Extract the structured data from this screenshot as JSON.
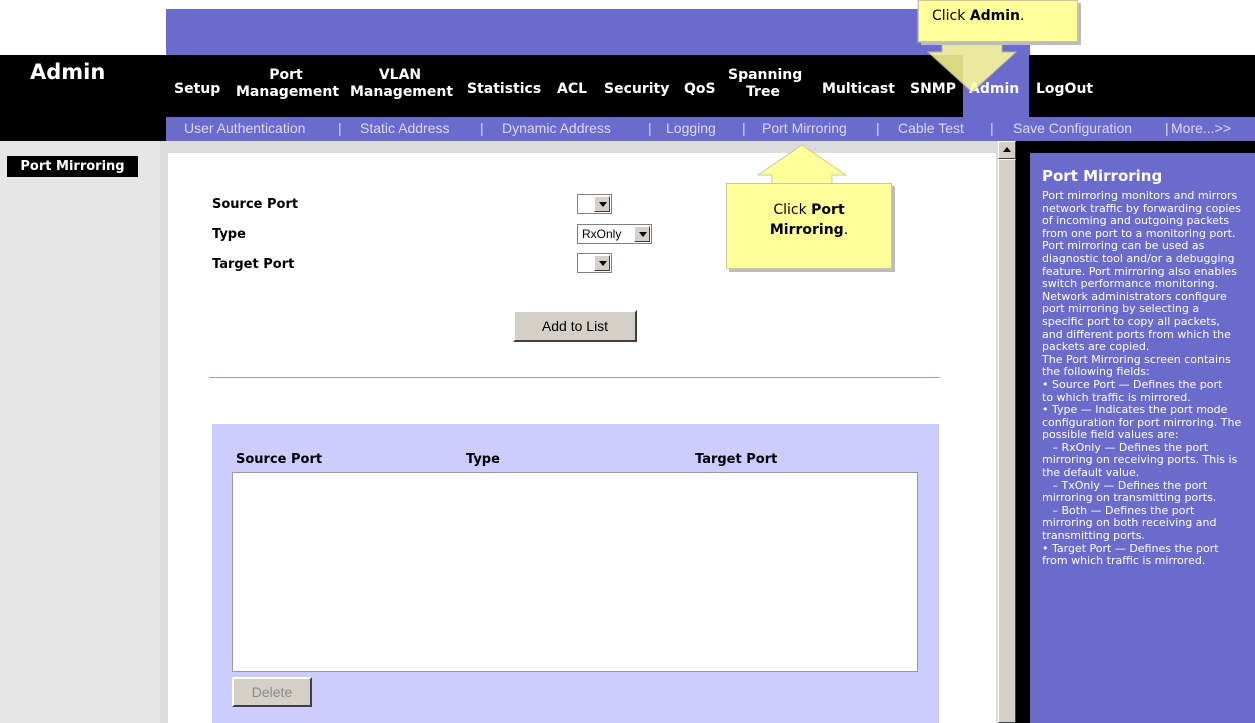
{
  "header": {
    "section_title": "Admin"
  },
  "nav": {
    "tabs": [
      {
        "line1": "Setup",
        "line2": ""
      },
      {
        "line1": "Port",
        "line2": "Management"
      },
      {
        "line1": "VLAN",
        "line2": "Management"
      },
      {
        "line1": "Statistics",
        "line2": ""
      },
      {
        "line1": "ACL",
        "line2": ""
      },
      {
        "line1": "Security",
        "line2": ""
      },
      {
        "line1": "QoS",
        "line2": ""
      },
      {
        "line1": "Spanning",
        "line2": "Tree"
      },
      {
        "line1": "Multicast",
        "line2": ""
      },
      {
        "line1": "SNMP",
        "line2": ""
      },
      {
        "line1": "Admin",
        "line2": ""
      },
      {
        "line1": "LogOut",
        "line2": ""
      }
    ],
    "active_tab": "Admin"
  },
  "subnav": {
    "items": [
      "User Authentication",
      "Static Address",
      "Dynamic Address",
      "Logging",
      "Port Mirroring",
      "Cable Test",
      "Save Configuration",
      "More...>>"
    ],
    "separator": "|"
  },
  "sidebar": {
    "label": "Port Mirroring"
  },
  "form": {
    "source_port_label": "Source Port",
    "type_label": "Type",
    "target_port_label": "Target Port",
    "source_port_value": "",
    "type_value": "RxOnly",
    "target_port_value": "",
    "add_button": "Add to List"
  },
  "table": {
    "headers": [
      "Source Port",
      "Type",
      "Target Port"
    ],
    "rows": [],
    "delete_button": "Delete"
  },
  "help": {
    "title": "Port Mirroring",
    "body": "Port mirroring monitors and mirrors\nnetwork traffic by forwarding copies\nof incoming and outgoing packets\nfrom one port to a monitoring port.\nPort mirroring can be used as\ndiagnostic tool and/or a debugging\nfeature. Port mirroring also enables\nswitch performance monitoring.\nNetwork administrators configure\nport mirroring by selecting a\nspecific port to copy all packets,\nand different ports from which the\npackets are copied.\nThe Port Mirroring screen contains\nthe following fields:\n• Source Port — Defines the port\nto which traffic is mirrored.\n• Type — Indicates the port mode\nconfiguration for port mirroring. The\npossible field values are:\n   – RxOnly — Defines the port\nmirroring on receiving ports. This is\nthe default value.\n   – TxOnly — Defines the port\nmirroring on transmitting ports.\n   – Both — Defines the port\nmirroring on both receiving and\ntransmitting ports.\n• Target Port — Defines the port\nfrom which traffic is mirrored."
  },
  "callouts": {
    "admin_prefix": "Click ",
    "admin_bold": "Admin",
    "admin_suffix": ".",
    "port_prefix": "Click ",
    "port_bold_line1": "Port",
    "port_bold_line2": "Mirroring",
    "port_suffix": "."
  },
  "colors": {
    "accent": "#6b6bcc",
    "panel": "#ccccff",
    "callout": "#ffff99"
  }
}
